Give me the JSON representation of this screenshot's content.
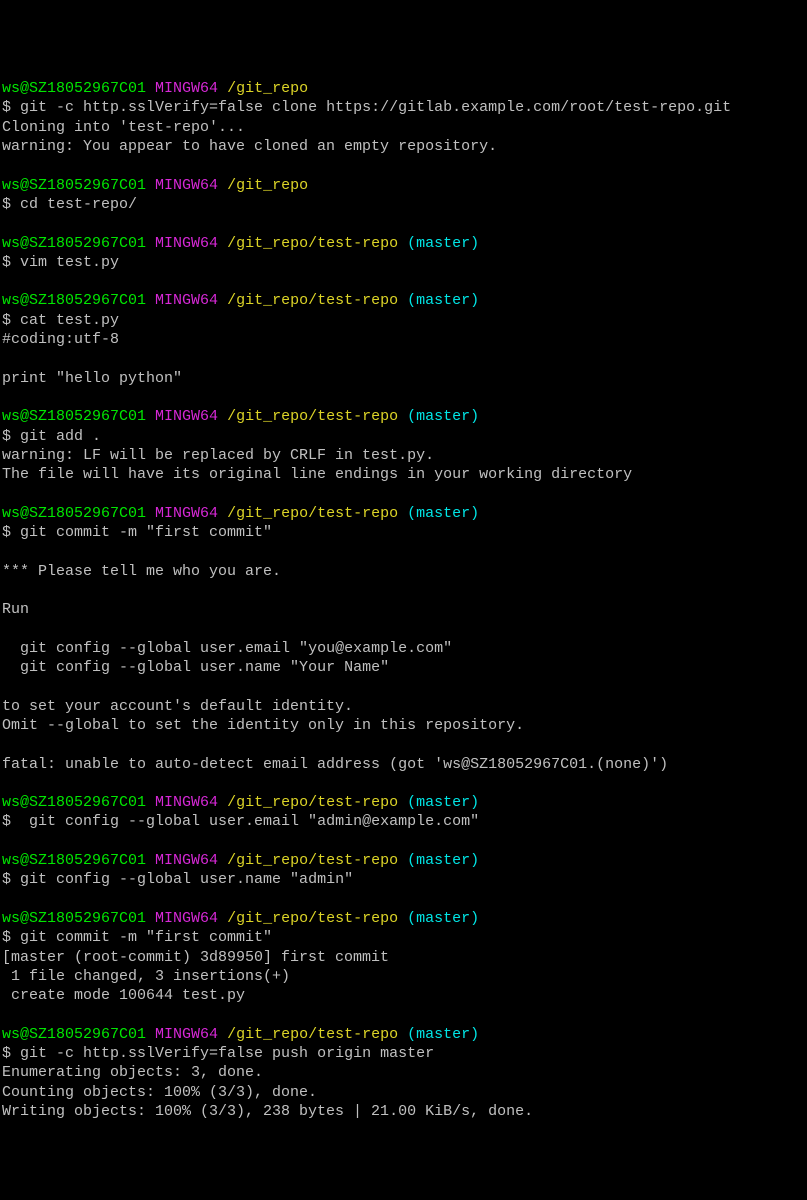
{
  "prompt": {
    "user": "ws@SZ18052967C01",
    "space": " ",
    "host": "MINGW64",
    "path_root": "/git_repo",
    "path_repo": "/git_repo/test-repo",
    "branch_open": " (",
    "branch": "master",
    "branch_close": ")"
  },
  "dollar": "$ ",
  "dollar_pad": "$  ",
  "blocks": [
    {
      "cmd": "git -c http.sslVerify=false clone https://gitlab.example.com/root/test-repo.git",
      "out": "Cloning into 'test-repo'...\nwarning: You appear to have cloned an empty repository."
    },
    {
      "cmd": "cd test-repo/"
    },
    {
      "cmd": "vim test.py"
    },
    {
      "cmd": "cat test.py",
      "out": "#coding:utf-8\n\nprint \"hello python\""
    },
    {
      "cmd": "git add .",
      "out": "warning: LF will be replaced by CRLF in test.py.\nThe file will have its original line endings in your working directory"
    },
    {
      "cmd": "git commit -m \"first commit\"",
      "out": "\n*** Please tell me who you are.\n\nRun\n\n  git config --global user.email \"you@example.com\"\n  git config --global user.name \"Your Name\"\n\nto set your account's default identity.\nOmit --global to set the identity only in this repository.\n\nfatal: unable to auto-detect email address (got 'ws@SZ18052967C01.(none)')"
    },
    {
      "cmd": "git config --global user.email \"admin@example.com\""
    },
    {
      "cmd": "git config --global user.name \"admin\""
    },
    {
      "cmd": "git commit -m \"first commit\"",
      "out": "[master (root-commit) 3d89950] first commit\n 1 file changed, 3 insertions(+)\n create mode 100644 test.py"
    },
    {
      "cmd": "git -c http.sslVerify=false push origin master",
      "out": "Enumerating objects: 3, done.\nCounting objects: 100% (3/3), done.\nWriting objects: 100% (3/3), 238 bytes | 21.00 KiB/s, done."
    }
  ]
}
